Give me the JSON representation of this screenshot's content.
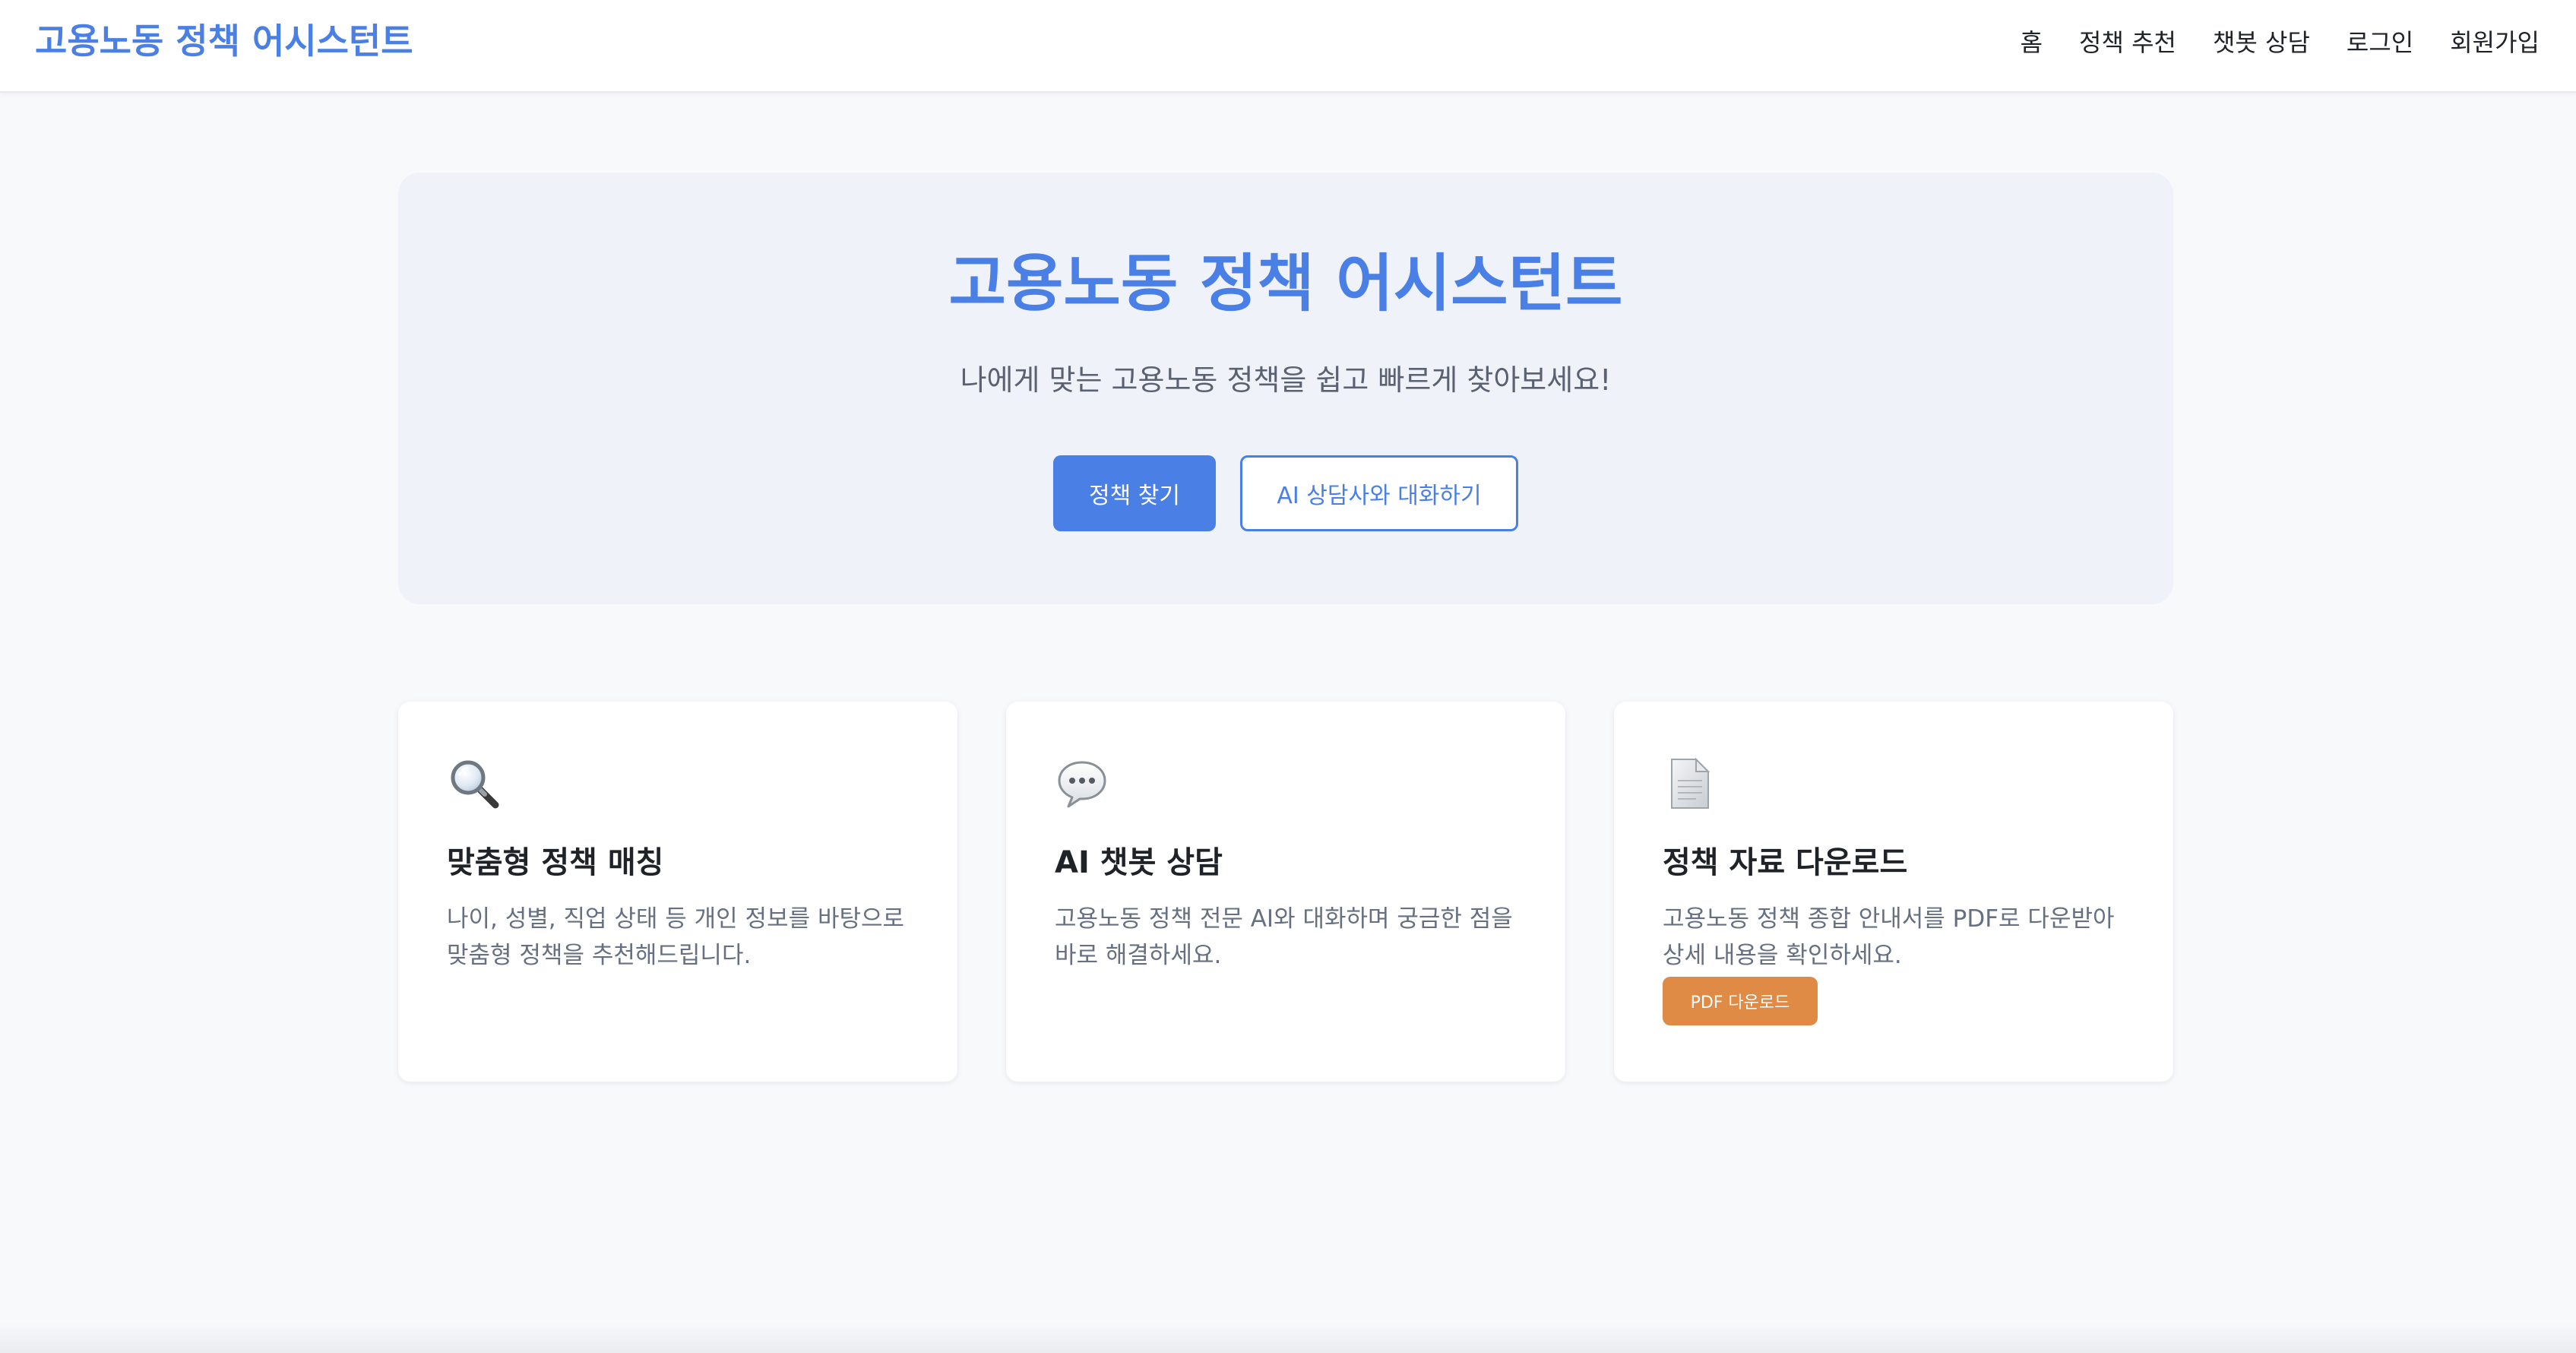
{
  "header": {
    "brand": "고용노동 정책 어시스턴트",
    "nav": [
      {
        "label": "홈"
      },
      {
        "label": "정책 추천"
      },
      {
        "label": "챗봇 상담"
      },
      {
        "label": "로그인"
      },
      {
        "label": "회원가입"
      }
    ]
  },
  "hero": {
    "title": "고용노동 정책 어시스턴트",
    "subtitle": "나에게 맞는 고용노동 정책을 쉽고 빠르게 찾아보세요!",
    "primary_button": "정책 찾기",
    "secondary_button": "AI 상담사와 대화하기"
  },
  "features": [
    {
      "icon": "magnifier-icon",
      "title": "맞춤형 정책 매칭",
      "description": "나이, 성별, 직업 상태 등 개인 정보를 바탕으로 맞춤형 정책을 추천해드립니다."
    },
    {
      "icon": "speech-bubble-icon",
      "title": "AI 챗봇 상담",
      "description": "고용노동 정책 전문 AI와 대화하며 궁금한 점을 바로 해결하세요."
    },
    {
      "icon": "document-icon",
      "title": "정책 자료 다운로드",
      "description": "고용노동 정책 종합 안내서를 PDF로 다운받아 상세 내용을 확인하세요.",
      "button": "PDF 다운로드"
    }
  ],
  "colors": {
    "brand_blue": "#4a7fe6",
    "pdf_orange": "#df8a45",
    "hero_bg": "#eff2f9",
    "page_bg": "#f8f9fb"
  }
}
